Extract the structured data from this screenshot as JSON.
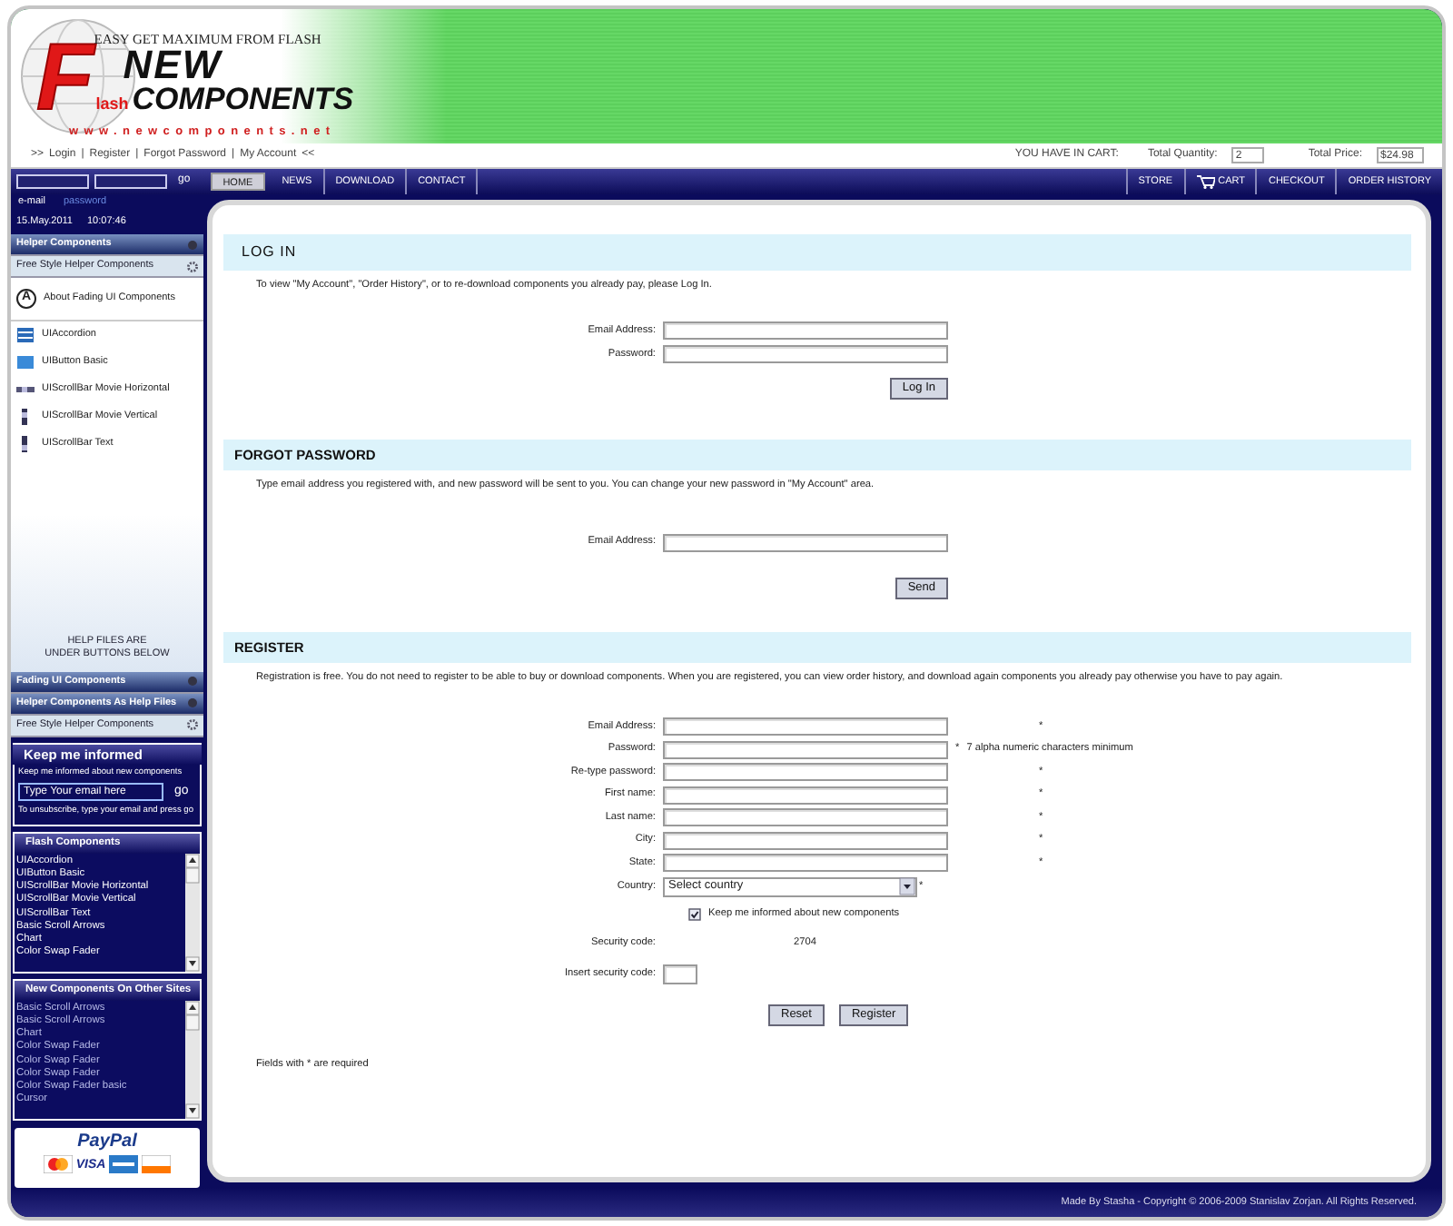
{
  "header": {
    "tagline": "EASY GET MAXIMUM FROM FLASH",
    "logo": {
      "letter": "F",
      "rest": "lash",
      "top": "NEW",
      "name": "COMPONENTS",
      "url": "www.newcomponents.net"
    }
  },
  "top_links": {
    "open": ">>",
    "separator": "|",
    "items": [
      "Login",
      "Register",
      "Forgot Password",
      "My Account"
    ],
    "close": "<<"
  },
  "cart": {
    "label": "YOU HAVE IN CART:",
    "quantity_label": "Total Quantity:",
    "quantity": "2",
    "price_label": "Total Price:",
    "price": "$24.98"
  },
  "login_bar": {
    "go": "go",
    "email_label": "e-mail",
    "password_label": "password",
    "date": "15.May.2011",
    "time": "10:07:46"
  },
  "nav": {
    "left": [
      {
        "label": "HOME",
        "selected": true
      },
      {
        "label": "NEWS",
        "selected": false
      },
      {
        "label": "DOWNLOAD",
        "selected": false
      },
      {
        "label": "CONTACT",
        "selected": false
      }
    ],
    "right": [
      {
        "label": "STORE",
        "kind": "plain"
      },
      {
        "label": "CART",
        "kind": "cart"
      },
      {
        "label": "CHECKOUT",
        "kind": "plain"
      },
      {
        "label": "ORDER HISTORY",
        "kind": "plain"
      }
    ]
  },
  "sidebar": {
    "top_groups": [
      {
        "label": "Helper Components",
        "selected": false
      },
      {
        "label": "Free Style Helper Components",
        "selected": true
      }
    ],
    "items": [
      {
        "label": "About Fading UI Components",
        "kind": "about",
        "badge": "A"
      },
      {
        "label": "UIAccordion",
        "kind": "accordion"
      },
      {
        "label": "UIButton Basic",
        "kind": "button"
      },
      {
        "label": "UIScrollBar Movie Horizontal",
        "kind": "hscroll"
      },
      {
        "label": "UIScrollBar Movie Vertical",
        "kind": "vscroll"
      },
      {
        "label": "UIScrollBar Text",
        "kind": "text"
      }
    ],
    "help": [
      "HELP FILES ARE",
      "UNDER BUTTONS BELOW"
    ],
    "bottom_groups": [
      {
        "label": "Fading UI Components",
        "selected": false
      },
      {
        "label": "Helper Components As Help Files",
        "selected": false
      },
      {
        "label": "Free Style Helper Components",
        "selected": true
      }
    ],
    "newsletter": {
      "title": "Keep me informed",
      "text": "Keep me informed about new components",
      "placeholder": "Type Your email here",
      "go": "go",
      "note": "To unsubscribe, type your email and press go"
    },
    "lists": [
      {
        "title": "Flash Components",
        "kind": "bright",
        "items": [
          "UIAccordion",
          "UIButton Basic",
          "UIScrollBar Movie Horizontal",
          "UIScrollBar Movie Vertical",
          "UIScrollBar Text",
          "Basic Scroll Arrows",
          "Chart",
          "Color Swap Fader"
        ]
      },
      {
        "title": "New Components On Other Sites",
        "kind": "dim",
        "items": [
          "Basic Scroll Arrows",
          "Basic Scroll Arrows",
          "Chart",
          "Color Swap Fader",
          "Color Swap Fader",
          "Color Swap Fader",
          "Color Swap Fader basic",
          "Cursor"
        ]
      }
    ],
    "paypal": {
      "brand": "PayPal",
      "cards": [
        {
          "kind": "mastercard"
        },
        {
          "kind": "text",
          "label": "VISA"
        },
        {
          "kind": "amex"
        },
        {
          "kind": "discover"
        }
      ]
    }
  },
  "sections": [
    {
      "kind": "login",
      "title": "LOG IN",
      "text": "To view \"My Account\", \"Order History\", or to re-download components you already pay, please Log In.",
      "fields": [
        {
          "label": "Email Address:",
          "kind": "text",
          "required": false
        },
        {
          "label": "Password:",
          "kind": "password",
          "required": false
        }
      ],
      "buttons": [
        "Log In"
      ]
    },
    {
      "kind": "forgot",
      "title": "FORGOT PASSWORD",
      "text": "Type email address you registered with, and new password will be sent to you. You can change your new password in \"My Account\" area.",
      "fields": [
        {
          "label": "Email Address:",
          "kind": "text",
          "required": false
        }
      ],
      "buttons": [
        "Send"
      ]
    },
    {
      "kind": "register",
      "required_mark": "*",
      "title": "REGISTER",
      "text": "Registration is free. You do not need to register to be able to buy or download components. When you are registered, you can view order history, and download again components you already pay otherwise you have to pay again.",
      "fields": [
        {
          "label": "Email Address:",
          "kind": "text",
          "required": true
        },
        {
          "label": "Password:",
          "kind": "password",
          "required": true,
          "note": "7 alpha numeric characters minimum"
        },
        {
          "label": "Re-type password:",
          "kind": "password",
          "required": true
        },
        {
          "label": "First name:",
          "kind": "text",
          "required": true
        },
        {
          "label": "Last name:",
          "kind": "text",
          "required": true
        },
        {
          "label": "City:",
          "kind": "text",
          "required": true
        },
        {
          "label": "State:",
          "kind": "text",
          "required": true
        },
        {
          "label": "Country:",
          "kind": "select",
          "value": "Select country",
          "required": true
        },
        {
          "label": "Keep me informed about new components",
          "kind": "checkbox",
          "checked": true,
          "required": false
        },
        {
          "label": "Security code:",
          "kind": "code",
          "value": "2704",
          "required": false
        },
        {
          "label": "Insert security code:",
          "kind": "short",
          "required": false
        }
      ],
      "buttons": [
        "Reset",
        "Register"
      ],
      "footnote": "Fields with * are required"
    }
  ],
  "footer": "Made By Stasha - Copyright © 2006-2009 Stanislav Zorjan. All Rights Reserved."
}
